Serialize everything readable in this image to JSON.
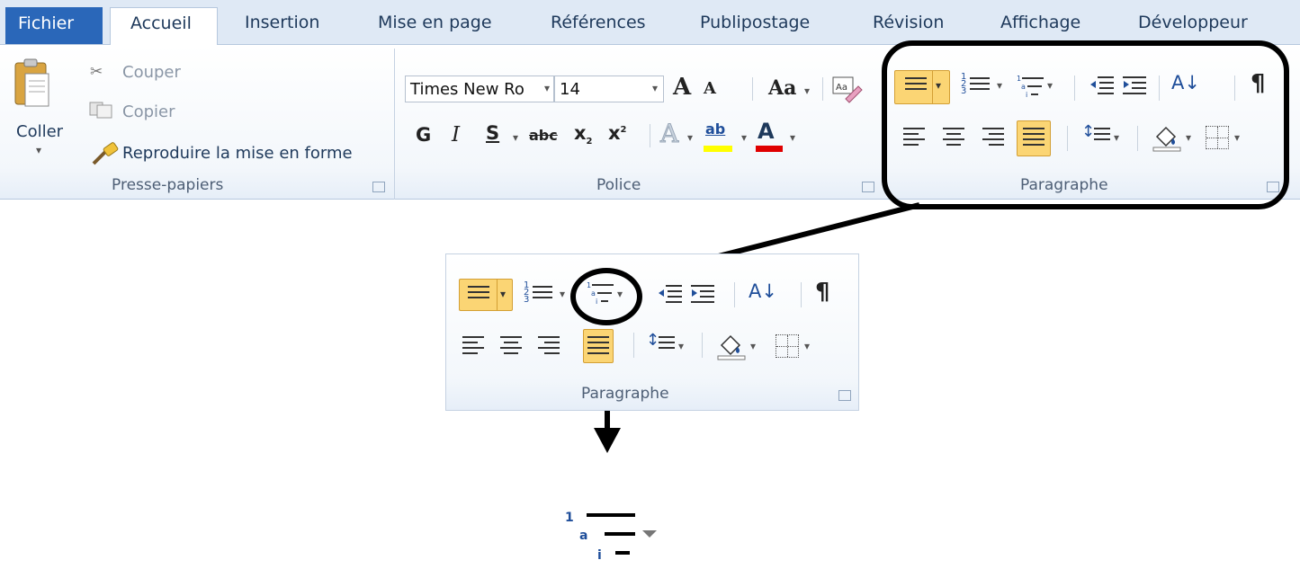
{
  "tabs": [
    "Fichier",
    "Accueil",
    "Insertion",
    "Mise en page",
    "Références",
    "Publipostage",
    "Révision",
    "Affichage",
    "Développeur"
  ],
  "clipboard": {
    "paste_label": "Coller",
    "cut_label": "Couper",
    "copy_label": "Copier",
    "format_painter_label": "Reproduire la mise en forme",
    "group_label": "Presse-papiers"
  },
  "font": {
    "font_name": "Times New Ro",
    "font_size": "14",
    "grow_glyph": "A",
    "shrink_glyph": "A",
    "change_case_glyph": "Aa",
    "bold_glyph": "G",
    "italic_glyph": "I",
    "underline_glyph": "S",
    "strike_glyph": "abc",
    "subscript_glyph": "x",
    "superscript_glyph": "x",
    "effects_glyph": "A",
    "highlight_glyph": "ab",
    "color_glyph": "A",
    "group_label": "Police"
  },
  "paragraph": {
    "group_label": "Paragraphe",
    "sort_glyph": "A↓",
    "pilcrow_glyph": "¶",
    "active_color": "#fbd574"
  },
  "zoom_panel": {
    "group_label": "Paragraphe"
  },
  "colors": {
    "file_tab": "#2a67b9",
    "highlight_yellow": "#ffff00",
    "font_red": "#e00000",
    "callout": "#000000"
  }
}
